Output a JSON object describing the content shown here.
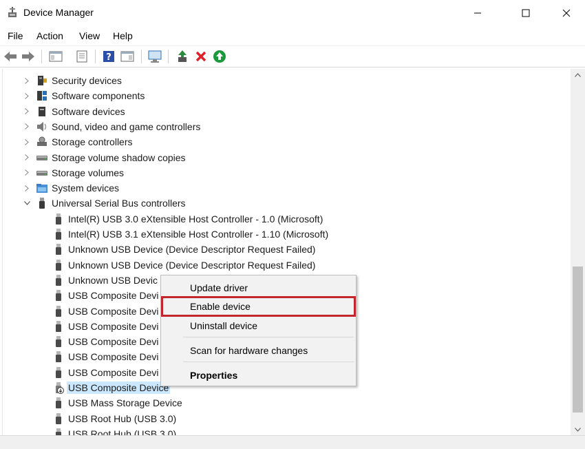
{
  "window": {
    "title": "Device Manager"
  },
  "menu": [
    "File",
    "Action",
    "View",
    "Help"
  ],
  "toolbar": {
    "buttons": [
      "back-arrow-icon",
      "forward-arrow-icon",
      "show-hide-console-tree-icon",
      "properties-icon",
      "help-icon",
      "action-pane-icon",
      "monitor-icon",
      "update-driver-icon",
      "uninstall-icon",
      "enable-device-icon"
    ],
    "colors": {
      "uninstall": "#e01f26",
      "enable": "#1a9a3a",
      "update": "#2e8b3d"
    }
  },
  "tree": {
    "categories": [
      {
        "label": "Security devices",
        "icon": "security-device-icon",
        "expanded": false
      },
      {
        "label": "Software components",
        "icon": "software-component-icon",
        "expanded": false
      },
      {
        "label": "Software devices",
        "icon": "software-device-icon",
        "expanded": false
      },
      {
        "label": "Sound, video and game controllers",
        "icon": "speaker-icon",
        "expanded": false
      },
      {
        "label": "Storage controllers",
        "icon": "storage-controller-icon",
        "expanded": false
      },
      {
        "label": "Storage volume shadow copies",
        "icon": "drive-icon",
        "expanded": false
      },
      {
        "label": "Storage volumes",
        "icon": "drive-icon",
        "expanded": false
      },
      {
        "label": "System devices",
        "icon": "system-folder-icon",
        "expanded": false
      },
      {
        "label": "Universal Serial Bus controllers",
        "icon": "usb-icon",
        "expanded": true
      }
    ],
    "usb_children": [
      {
        "label": "Intel(R) USB 3.0 eXtensible Host Controller - 1.0 (Microsoft)",
        "icon": "usb-plug-icon"
      },
      {
        "label": "Intel(R) USB 3.1 eXtensible Host Controller - 1.10 (Microsoft)",
        "icon": "usb-plug-icon"
      },
      {
        "label": "Unknown USB Device (Device Descriptor Request Failed)",
        "icon": "usb-plug-icon"
      },
      {
        "label": "Unknown USB Device (Device Descriptor Request Failed)",
        "icon": "usb-plug-icon"
      },
      {
        "label": "Unknown USB Devic",
        "icon": "usb-plug-icon"
      },
      {
        "label": "USB Composite Devi",
        "icon": "usb-plug-icon"
      },
      {
        "label": "USB Composite Devi",
        "icon": "usb-plug-icon"
      },
      {
        "label": "USB Composite Devi",
        "icon": "usb-plug-icon"
      },
      {
        "label": "USB Composite Devi",
        "icon": "usb-plug-icon"
      },
      {
        "label": "USB Composite Devi",
        "icon": "usb-plug-icon"
      },
      {
        "label": "USB Composite Devi",
        "icon": "usb-plug-icon"
      },
      {
        "label": "USB Composite Device",
        "icon": "usb-disabled-icon",
        "selected": true
      },
      {
        "label": "USB Mass Storage Device",
        "icon": "usb-plug-icon"
      },
      {
        "label": "USB Root Hub (USB 3.0)",
        "icon": "usb-plug-icon"
      },
      {
        "label": "USB Root Hub (USB 3.0)",
        "icon": "usb-plug-icon"
      }
    ]
  },
  "context_menu": {
    "update_driver": "Update driver",
    "enable_device": "Enable device",
    "uninstall_device": "Uninstall device",
    "scan_hardware": "Scan for hardware changes",
    "properties": "Properties",
    "highlight_color": "#c4262e"
  }
}
